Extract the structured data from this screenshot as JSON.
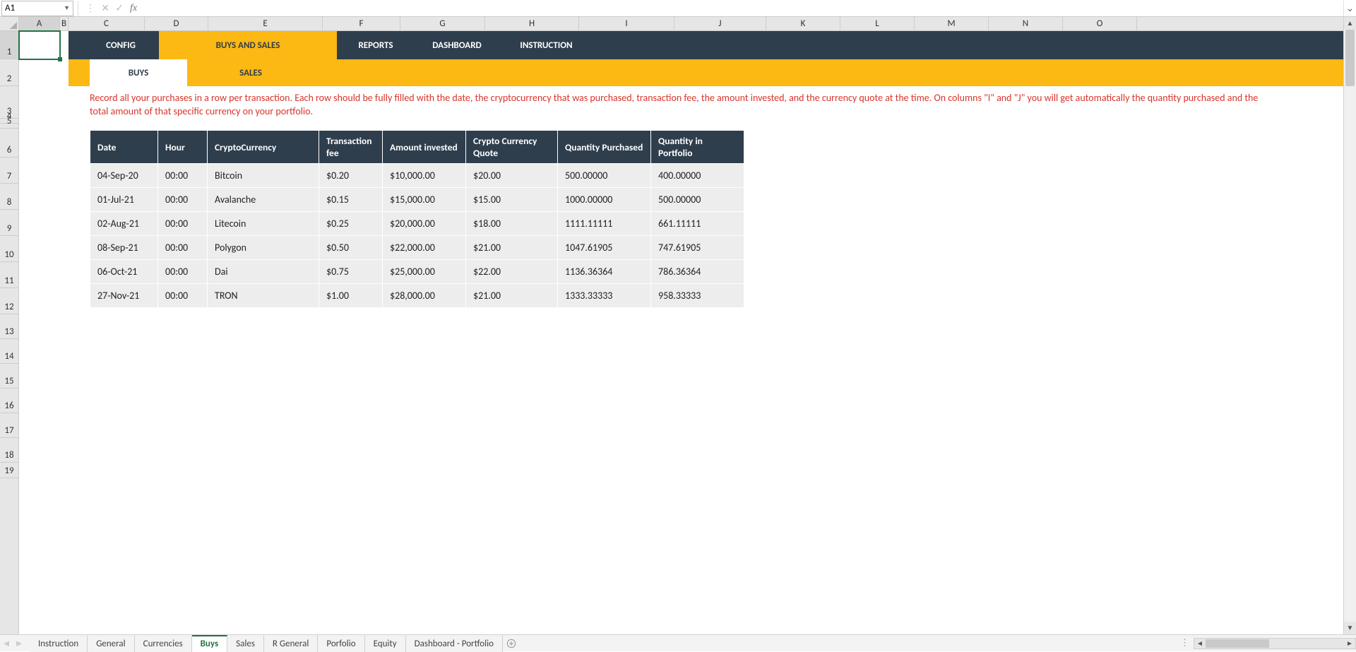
{
  "name_box": "A1",
  "formula_value": "",
  "columns": [
    "A",
    "B",
    "C",
    "D",
    "E",
    "F",
    "G",
    "H",
    "I",
    "J",
    "K",
    "L",
    "M",
    "N",
    "O"
  ],
  "row_labels": [
    "1",
    "2",
    "3",
    "4",
    "5",
    "6",
    "7",
    "8",
    "9",
    "10",
    "11",
    "12",
    "13",
    "14",
    "15",
    "16",
    "17",
    "18",
    "19"
  ],
  "nav": {
    "config": "CONFIG",
    "buys_sales": "BUYS AND SALES",
    "reports": "REPORTS",
    "dashboard": "DASHBOARD",
    "instruction": "INSTRUCTION"
  },
  "subnav": {
    "buys": "BUYS",
    "sales": "SALES"
  },
  "instruction_text": "Record all your purchases in a row per transaction. Each row should be fully filled with the date, the cryptocurrency that was purchased, transaction fee, the amount invested, and the currency quote at the time. On columns \"I\" and \"J\" you will get automatically the quantity purchased and the total amount of that specific currency on your portfolio.",
  "headers": {
    "date": "Date",
    "hour": "Hour",
    "cc": "CryptoCurrency",
    "fee": "Transaction fee",
    "amt": "Amount invested",
    "quote": "Crypto Currency Quote",
    "qp": "Quantity Purchased",
    "qip": "Quantity in Portfolio"
  },
  "rows": [
    {
      "date": "04-Sep-20",
      "hour": "00:00",
      "cc": "Bitcoin",
      "fee": "$0.20",
      "amt": "$10,000.00",
      "quote": "$20.00",
      "qp": "500.00000",
      "qip": "400.00000"
    },
    {
      "date": "01-Jul-21",
      "hour": "00:00",
      "cc": "Avalanche",
      "fee": "$0.15",
      "amt": "$15,000.00",
      "quote": "$15.00",
      "qp": "1000.00000",
      "qip": "500.00000"
    },
    {
      "date": "02-Aug-21",
      "hour": "00:00",
      "cc": "Litecoin",
      "fee": "$0.25",
      "amt": "$20,000.00",
      "quote": "$18.00",
      "qp": "1111.11111",
      "qip": "661.11111"
    },
    {
      "date": "08-Sep-21",
      "hour": "00:00",
      "cc": "Polygon",
      "fee": "$0.50",
      "amt": "$22,000.00",
      "quote": "$21.00",
      "qp": "1047.61905",
      "qip": "747.61905"
    },
    {
      "date": "06-Oct-21",
      "hour": "00:00",
      "cc": "Dai",
      "fee": "$0.75",
      "amt": "$25,000.00",
      "quote": "$22.00",
      "qp": "1136.36364",
      "qip": "786.36364"
    },
    {
      "date": "27-Nov-21",
      "hour": "00:00",
      "cc": "TRON",
      "fee": "$1.00",
      "amt": "$28,000.00",
      "quote": "$21.00",
      "qp": "1333.33333",
      "qip": "958.33333"
    }
  ],
  "sheet_tabs": [
    "Instruction",
    "General",
    "Currencies",
    "Buys",
    "Sales",
    "R General",
    "Porfolio",
    "Equity",
    "Dashboard - Portfolio"
  ],
  "active_sheet": "Buys"
}
